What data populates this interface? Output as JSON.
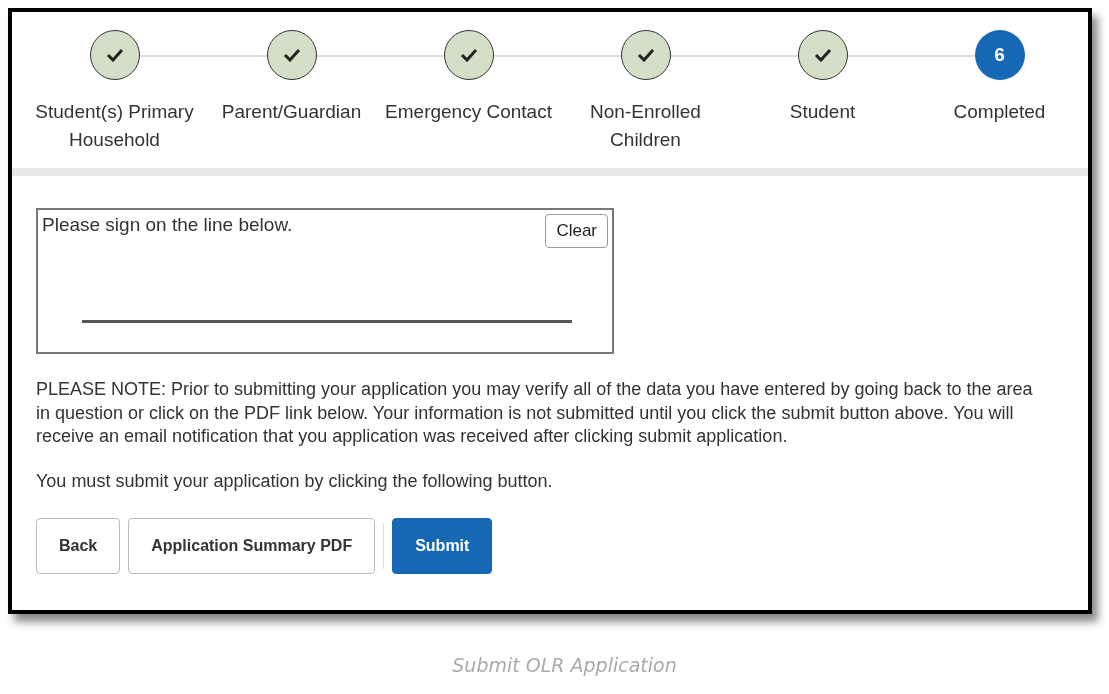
{
  "steps": [
    {
      "label": "Student(s) Primary Household",
      "completed": true,
      "selected": false
    },
    {
      "label": "Parent/Guardian",
      "completed": true,
      "selected": false
    },
    {
      "label": "Emergency Contact",
      "completed": true,
      "selected": false
    },
    {
      "label": "Non-Enrolled Children",
      "completed": true,
      "selected": false
    },
    {
      "label": "Student",
      "completed": true,
      "selected": false
    },
    {
      "label": "Completed",
      "completed": false,
      "selected": true,
      "number": "6"
    }
  ],
  "signature": {
    "prompt": "Please sign on the line below.",
    "clear_button": "Clear"
  },
  "note": "PLEASE NOTE: Prior to submitting your application you may verify all of the data you have entered by going back to the area in question or click on the PDF link below. Your information is not submitted until you click the submit button above. You will receive an email notification that you application was received after clicking submit application.",
  "instruction": "You must submit your application by clicking the following button.",
  "buttons": [
    {
      "label": "Back",
      "kind": "secondary"
    },
    {
      "label": "Application Summary PDF",
      "kind": "secondary"
    },
    {
      "label": "Submit",
      "kind": "primary"
    }
  ],
  "caption": "Submit OLR Application"
}
